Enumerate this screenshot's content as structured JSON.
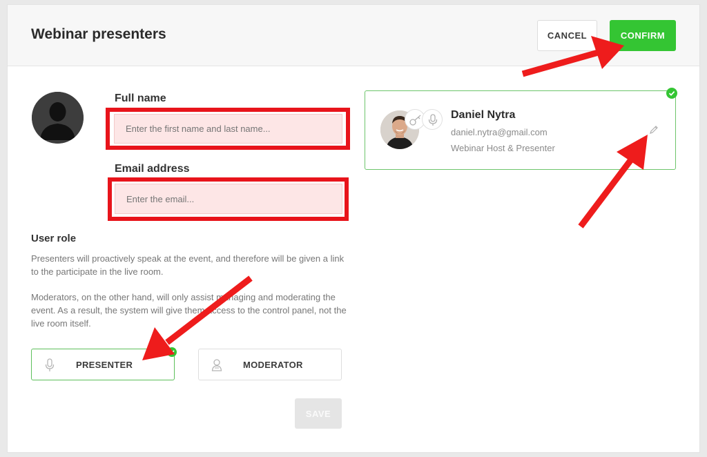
{
  "header": {
    "title": "Webinar presenters",
    "cancel_label": "CANCEL",
    "confirm_label": "CONFIRM"
  },
  "form": {
    "full_name": {
      "label": "Full name",
      "placeholder": "Enter the first name and last name..."
    },
    "email": {
      "label": "Email address",
      "placeholder": "Enter the email..."
    },
    "role_section": {
      "title": "User role",
      "paragraph_1": "Presenters will proactively speak at the event, and therefore will be given a link to the participate in the live room.",
      "paragraph_2": "Moderators, on the other hand, will only assist managing and moderating the event. As a result, the system will give them access to the control panel, not the live room itself.",
      "options": [
        {
          "label": "PRESENTER",
          "icon": "microphone-icon",
          "selected": true
        },
        {
          "label": "MODERATOR",
          "icon": "user-icon",
          "selected": false
        }
      ]
    },
    "save_label": "SAVE"
  },
  "presenter_card": {
    "name": "Daniel Nytra",
    "email": "daniel.nytra@gmail.com",
    "role": "Webinar Host & Presenter",
    "icons": [
      "key-icon",
      "microphone-icon",
      "pencil-icon",
      "check-icon"
    ]
  },
  "colors": {
    "accent_green": "#34c533",
    "highlight_red": "#e8141b",
    "input_error_bg": "#fde6e6"
  }
}
